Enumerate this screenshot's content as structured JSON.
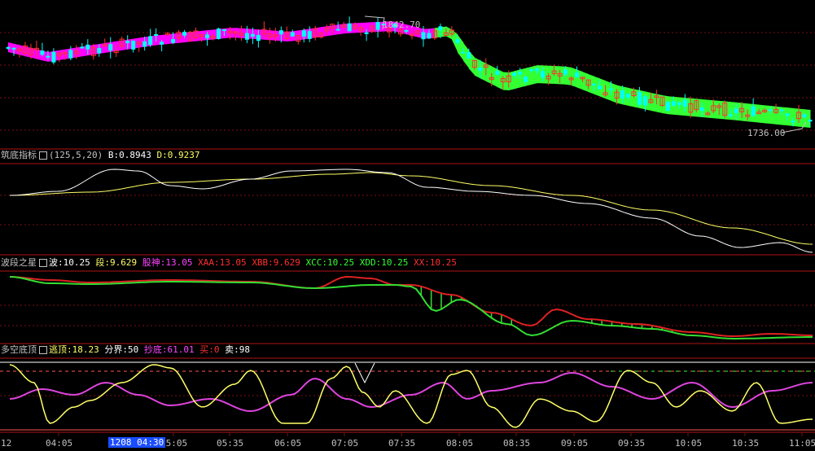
{
  "colors": {
    "bg": "#000000",
    "grid": "#7a1010",
    "separator": "#b01515",
    "up": "#ff3030",
    "down": "#00ffff",
    "ma_up": "#ff00ff",
    "ma_down": "#33ff33",
    "white_line": "#ffffff",
    "yellow_line": "#ffff66",
    "magenta_line": "#dd44dd",
    "red_line": "#dd2222",
    "green_line": "#33dd33",
    "label_gray": "#c0c0c0"
  },
  "panel1": {
    "high_label": "1842.70",
    "low_label": "1736.00"
  },
  "panel2": {
    "title": "筑底指标",
    "params": "(125,5,20)",
    "b_label": "B:0.8943",
    "d_label": "D:0.9237"
  },
  "panel3": {
    "title": "波段之星",
    "items": [
      {
        "text": "波:10.25",
        "color": "#ffffff"
      },
      {
        "text": "段:9.629",
        "color": "#ffff66"
      },
      {
        "text": "股神:13.05",
        "color": "#ff44ff"
      },
      {
        "text": "XAA:13.05",
        "color": "#ff3030"
      },
      {
        "text": "XBB:9.629",
        "color": "#ff3030"
      },
      {
        "text": "XCC:10.25",
        "color": "#33ff33"
      },
      {
        "text": "XDD:10.25",
        "color": "#33ff33"
      },
      {
        "text": "XX:10.25",
        "color": "#ff3030"
      }
    ]
  },
  "panel4": {
    "title": "多空底顶",
    "items": [
      {
        "text": "逃顶:18.23",
        "color": "#ffff66"
      },
      {
        "text": "分界:50",
        "color": "#ffffff"
      },
      {
        "text": "抄底:61.01",
        "color": "#ff44ff"
      },
      {
        "text": "买:0",
        "color": "#ff3030"
      },
      {
        "text": "卖:98",
        "color": "#ffffff"
      }
    ]
  },
  "time_axis": {
    "left_edge_label": "12",
    "ticks": [
      "04:05",
      "05:05",
      "05:35",
      "06:05",
      "07:05",
      "07:35",
      "08:05",
      "08:35",
      "09:05",
      "09:35",
      "10:05",
      "10:35",
      "11:05"
    ],
    "selected": "1208 04:30"
  },
  "chart_data": {
    "type": "line",
    "price_high": 1842.7,
    "price_low": 1736.0,
    "candles_description": "intraday candlesticks with moving-average band",
    "zhudi_series": [
      "B",
      "D"
    ],
    "duokong_series": [
      "逃顶",
      "抄底"
    ]
  }
}
